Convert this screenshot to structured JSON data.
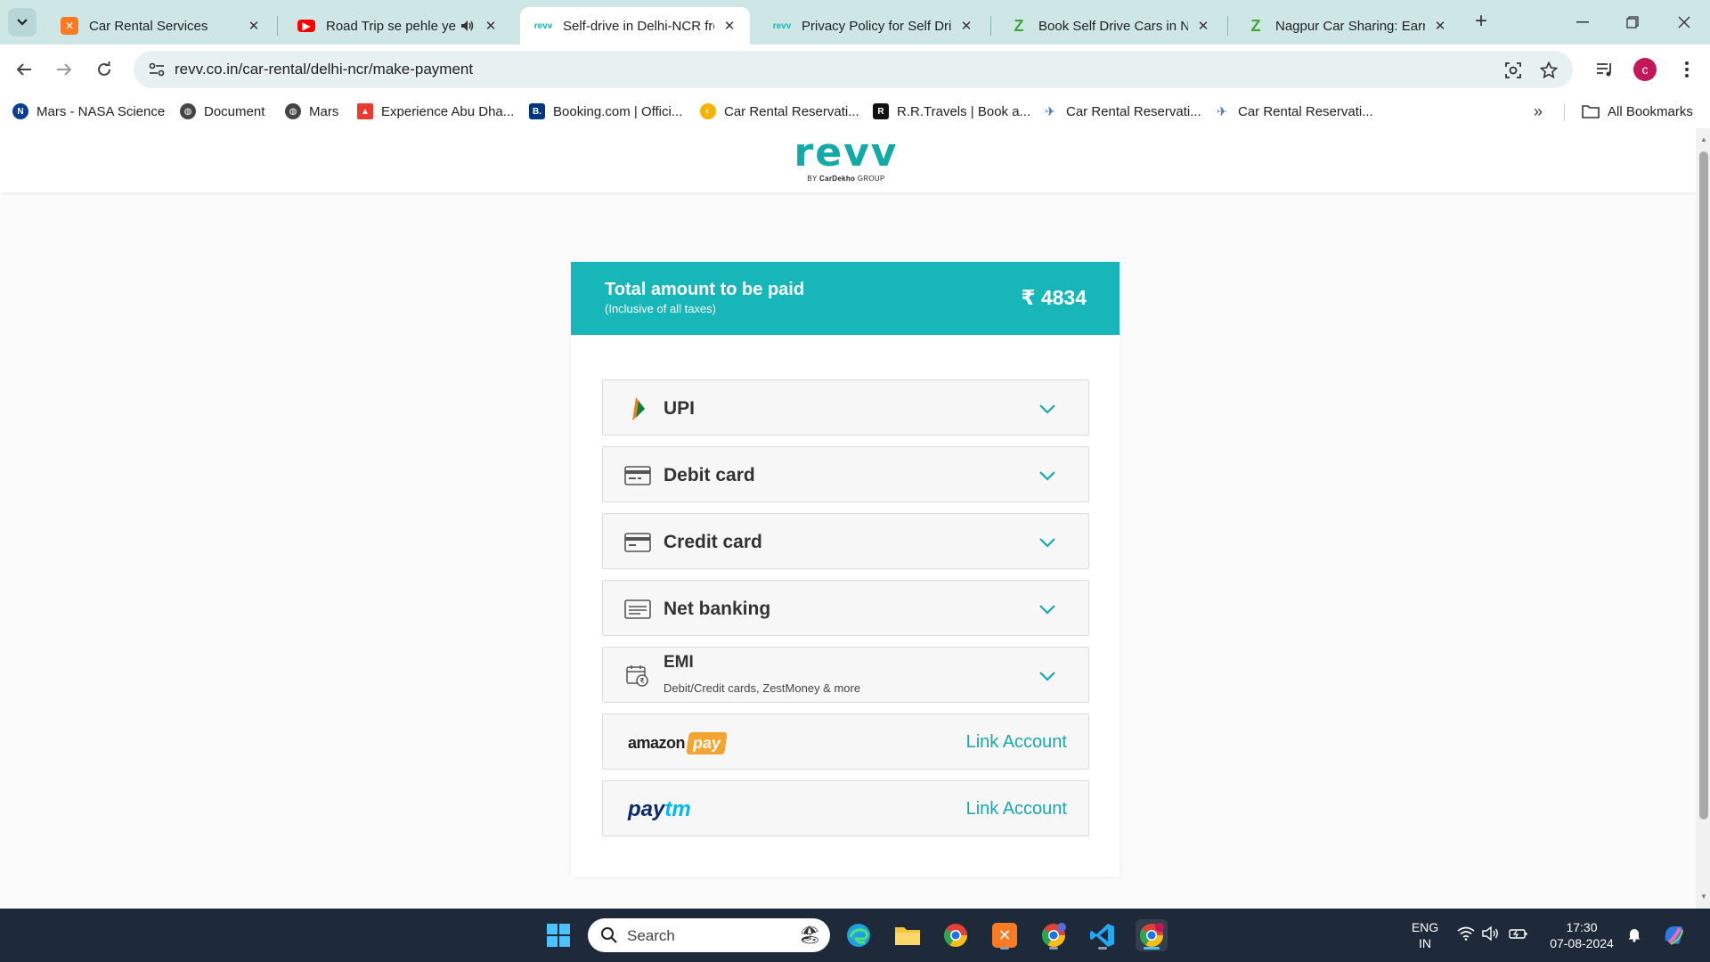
{
  "browser": {
    "tabs": [
      {
        "title": "Car Rental Services",
        "favicon": "xampp-icon",
        "active": false
      },
      {
        "title": "Road Trip se pehle ye k",
        "favicon": "youtube-icon",
        "active": false
      },
      {
        "title": "Self-drive in Delhi-NCR fro",
        "favicon": "revv-icon",
        "active": true
      },
      {
        "title": "Privacy Policy for Self Drivi",
        "favicon": "revv-icon",
        "active": false
      },
      {
        "title": "Book Self Drive Cars in Nag",
        "favicon": "zoomcar-icon",
        "active": false
      },
      {
        "title": "Nagpur Car Sharing: Earn w",
        "favicon": "zoomcar-icon",
        "active": false
      }
    ],
    "url": "revv.co.in/car-rental/delhi-ncr/make-payment",
    "avatar_letter": "c",
    "bookmarks": [
      {
        "label": "Mars - NASA Science",
        "icon": "nasa-icon",
        "color": "#0b3d91"
      },
      {
        "label": "Document",
        "icon": "globe-icon",
        "color": "#444444"
      },
      {
        "label": "Mars",
        "icon": "globe-icon",
        "color": "#444444"
      },
      {
        "label": "Experience Abu Dha...",
        "icon": "abu-dhabi-icon",
        "color": "#e63b2e"
      },
      {
        "label": "Booking.com | Offici...",
        "icon": "booking-icon",
        "color": "#003580"
      },
      {
        "label": "Car Rental Reservati...",
        "icon": "car-rental-icon",
        "color": "#f5b400"
      },
      {
        "label": "R.R.Travels | Book a...",
        "icon": "rr-travels-icon",
        "color": "#111111"
      },
      {
        "label": "Car Rental Reservati...",
        "icon": "plane-icon",
        "color": "#3a6fb0"
      },
      {
        "label": "Car Rental Reservati...",
        "icon": "plane-icon",
        "color": "#3a6fb0"
      }
    ],
    "all_bookmarks": "All Bookmarks"
  },
  "page": {
    "brand": {
      "wordmark": "revv",
      "tagline_prefix": "BY",
      "tagline_brand": "CarDekho",
      "tagline_suffix": "GROUP"
    },
    "total": {
      "title": "Total amount to be paid",
      "subtitle": "(Inclusive of all taxes)",
      "amount": "₹ 4834"
    },
    "payment_options": [
      {
        "label": "UPI",
        "icon": "upi-icon"
      },
      {
        "label": "Debit card",
        "icon": "debit-card-icon"
      },
      {
        "label": "Credit card",
        "icon": "credit-card-icon"
      },
      {
        "label": "Net banking",
        "icon": "net-banking-icon"
      },
      {
        "label": "EMI",
        "sub": "Debit/Credit cards, ZestMoney & more",
        "icon": "emi-icon"
      }
    ],
    "wallets": [
      {
        "brand": "amazon pay",
        "brand_a": "amazon",
        "brand_b": "pay",
        "link": "Link Account"
      },
      {
        "brand": "paytm",
        "brand_a": "pay",
        "brand_b": "tm",
        "link": "Link Account"
      }
    ],
    "accent": "#17b6b8"
  },
  "taskbar": {
    "search_label": "Search",
    "lang_top": "ENG",
    "lang_bottom": "IN",
    "time": "17:30",
    "date": "07-08-2024"
  }
}
